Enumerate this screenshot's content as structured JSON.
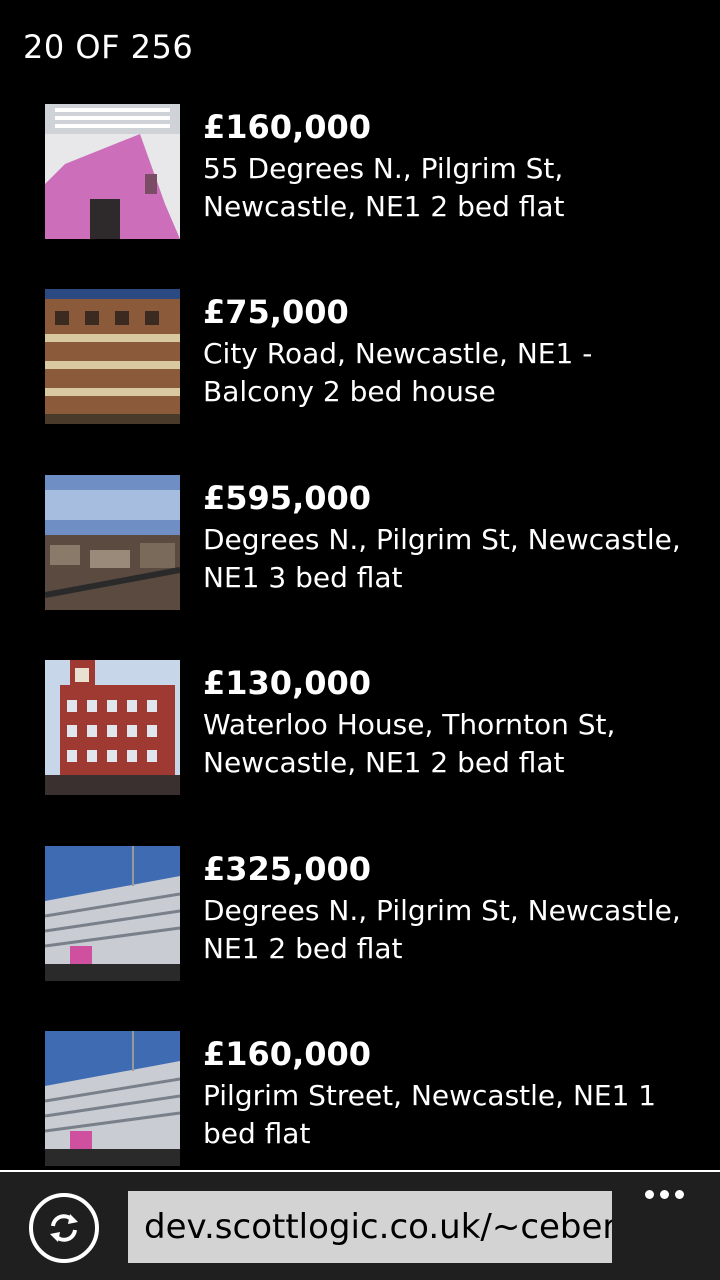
{
  "header": {
    "counter": "20 OF 256"
  },
  "listings": [
    {
      "price": "£160,000",
      "description": "55 Degrees N., Pilgrim St, Newcastle, NE1 2 bed flat"
    },
    {
      "price": "£75,000",
      "description": "City Road, Newcastle, NE1 - Balcony 2 bed house"
    },
    {
      "price": "£595,000",
      "description": "Degrees N., Pilgrim St, Newcastle, NE1 3 bed flat"
    },
    {
      "price": "£130,000",
      "description": "Waterloo House, Thornton St, Newcastle, NE1 2 bed flat"
    },
    {
      "price": "£325,000",
      "description": "Degrees N., Pilgrim St, Newcastle, NE1 2 bed flat"
    },
    {
      "price": "£160,000",
      "description": "Pilgrim Street, Newcastle, NE1 1 bed flat"
    }
  ],
  "appbar": {
    "url": "dev.scottlogic.co.uk/~ceberh",
    "refresh_icon": "refresh-icon",
    "more_icon": "more-icon"
  }
}
